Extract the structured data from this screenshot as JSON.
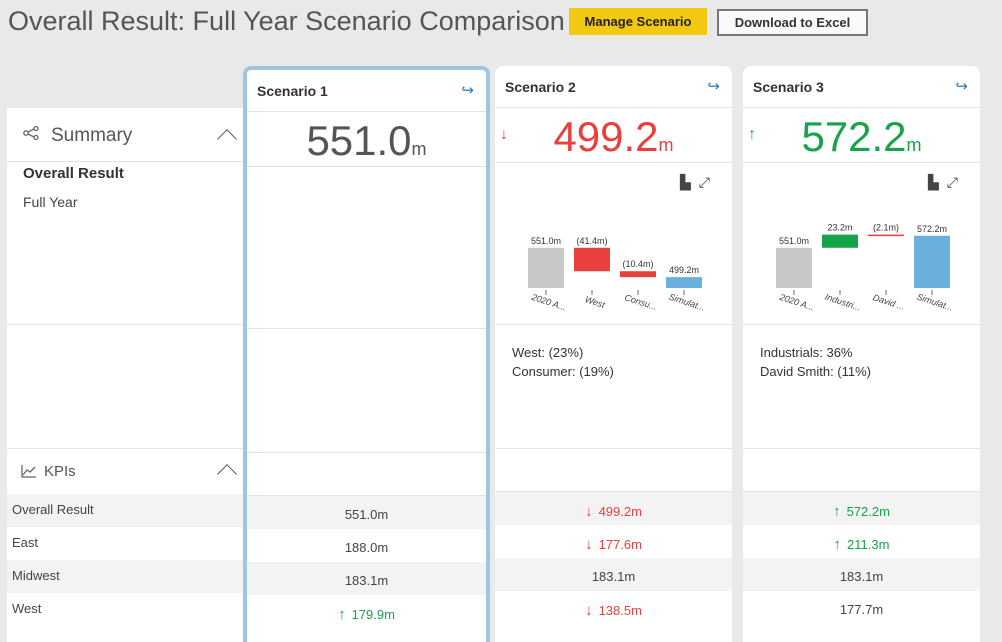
{
  "header": {
    "title": "Overall Result: Full Year Scenario Comparison",
    "manage_label": "Manage Scenario",
    "download_label": "Download to Excel"
  },
  "left": {
    "summary_title": "Summary",
    "overall_label": "Overall Result",
    "period_label": "Full Year",
    "kpis_title": "KPIs",
    "kpi_rows": [
      "Overall Result",
      "East",
      "Midwest",
      "West"
    ]
  },
  "colors": {
    "accent_blue": "#2b78c5",
    "red": "#e8413d",
    "green": "#16a34a",
    "highlight": "#9dc6e0",
    "bar_gray": "#c8c8c8",
    "bar_blue": "#6bb0dc",
    "bar_red": "#e8413d",
    "bar_green": "#16a34a"
  },
  "scenarios": [
    {
      "title": "Scenario 1",
      "value": "551.0",
      "unit": "m",
      "trend": "none",
      "explanations": [],
      "kpis": [
        {
          "value": "551.0m",
          "trend": "none"
        },
        {
          "value": "188.0m",
          "trend": "none"
        },
        {
          "value": "183.1m",
          "trend": "none"
        },
        {
          "value": "179.9m",
          "trend": "up"
        }
      ]
    },
    {
      "title": "Scenario 2",
      "value": "499.2",
      "unit": "m",
      "trend": "down",
      "explanations": [
        "West: (23%)",
        "Consumer: (19%)"
      ],
      "kpis": [
        {
          "value": "499.2m",
          "trend": "down"
        },
        {
          "value": "177.6m",
          "trend": "down"
        },
        {
          "value": "183.1m",
          "trend": "none"
        },
        {
          "value": "138.5m",
          "trend": "down"
        }
      ]
    },
    {
      "title": "Scenario 3",
      "value": "572.2",
      "unit": "m",
      "trend": "up",
      "explanations": [
        "Industrials: 36%",
        "David Smith: (11%)"
      ],
      "kpis": [
        {
          "value": "572.2m",
          "trend": "up"
        },
        {
          "value": "211.3m",
          "trend": "up"
        },
        {
          "value": "183.1m",
          "trend": "none"
        },
        {
          "value": "177.7m",
          "trend": "none"
        }
      ]
    }
  ],
  "chart_data": [
    {
      "type": "bar",
      "categories": [
        "2020 A...",
        "West",
        "Consu...",
        "Simulat..."
      ],
      "values": [
        551.0,
        -41.4,
        -10.4,
        499.2
      ],
      "data_labels": [
        "551.0m",
        "(41.4m)",
        "(10.4m)",
        "499.2m"
      ],
      "ylim": [
        0,
        600
      ]
    },
    {
      "type": "bar",
      "categories": [
        "2020 A...",
        "Industri...",
        "David ...",
        "Simulat..."
      ],
      "values": [
        551.0,
        23.2,
        -2.1,
        572.2
      ],
      "data_labels": [
        "551.0m",
        "23.2m",
        "(2.1m)",
        "572.2m"
      ],
      "ylim": [
        0,
        600
      ]
    }
  ]
}
